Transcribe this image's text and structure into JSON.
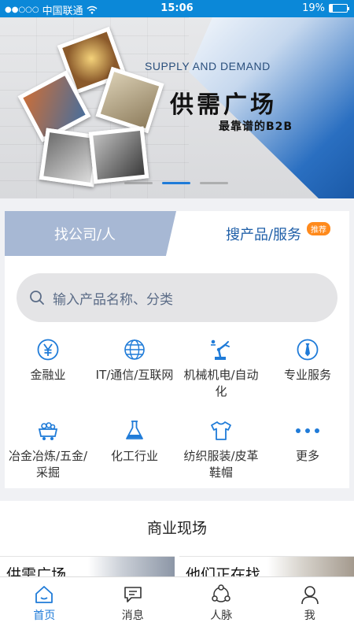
{
  "status_bar": {
    "carrier": "中国联通",
    "signal": "●●○○○",
    "time": "15:06",
    "battery": "19%",
    "battery_level": 0.19
  },
  "banner": {
    "subtitle_en": "SUPPLY AND DEMAND",
    "title": "供需广场",
    "tagline": "最靠谱的B2B",
    "slides": 3,
    "active_slide": 2
  },
  "search": {
    "tab_company": "找公司/人",
    "tab_product": "搜产品/服务",
    "tab_badge": "推荐",
    "placeholder": "输入产品名称、分类"
  },
  "categories": [
    {
      "label": "金融业",
      "icon": "yen-coin-icon"
    },
    {
      "label": "IT/通信/互联网",
      "icon": "globe-icon"
    },
    {
      "label": "机械机电/自动化",
      "icon": "robot-arm-icon"
    },
    {
      "label": "专业服务",
      "icon": "tie-icon"
    },
    {
      "label": "冶金冶炼/五金/采掘",
      "icon": "mine-cart-icon"
    },
    {
      "label": "化工行业",
      "icon": "flask-icon"
    },
    {
      "label": "纺织服装/皮革鞋帽",
      "icon": "tshirt-icon"
    },
    {
      "label": "更多",
      "icon": "more-dots-icon"
    }
  ],
  "business": {
    "title": "商业现场",
    "items": [
      {
        "text": "供需广场"
      },
      {
        "text": "他们正在找"
      }
    ]
  },
  "nav": {
    "items": [
      {
        "label": "首页",
        "icon": "home-icon"
      },
      {
        "label": "消息",
        "icon": "message-icon"
      },
      {
        "label": "人脉",
        "icon": "network-icon"
      },
      {
        "label": "我",
        "icon": "person-icon"
      }
    ]
  },
  "colors": {
    "accent": "#1f7bd8",
    "tab_inactive": "#a7b8d4",
    "badge": "#ff8a1c",
    "icon_blue": "#1f7bd8"
  }
}
